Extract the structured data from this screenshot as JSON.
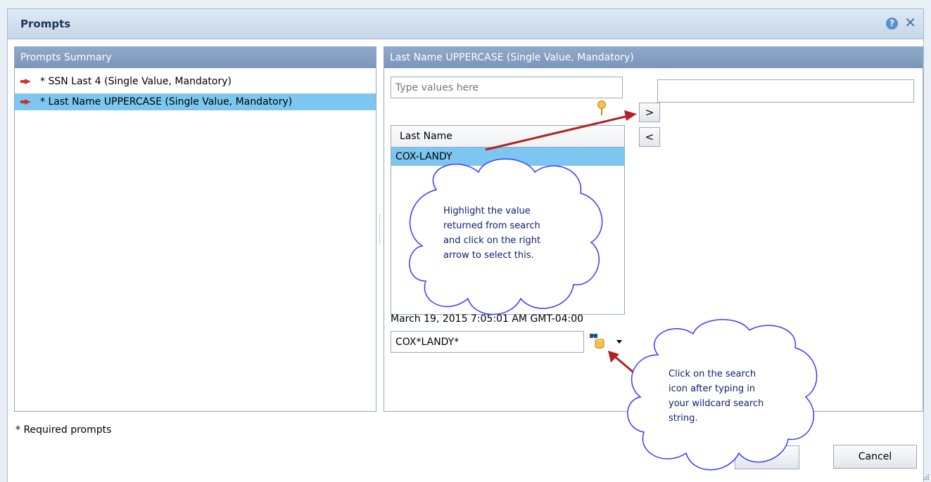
{
  "window": {
    "title": "Prompts",
    "help_icon": "help-icon",
    "close_icon": "close-icon",
    "close_glyph": "✕",
    "help_glyph": "?"
  },
  "left_panel": {
    "header": "Prompts Summary",
    "items": [
      {
        "label": "* SSN Last 4 (Single Value, Mandatory)",
        "icon": "red-arrow-icon",
        "selected": false
      },
      {
        "label": "* Last Name UPPERCASE (Single Value, Mandatory)",
        "icon": "red-arrow-icon",
        "selected": true
      }
    ]
  },
  "right_panel": {
    "header": "Last Name UPPERCASE (Single Value, Mandatory)",
    "type_values_placeholder": "Type values here",
    "add_button": ">",
    "remove_button": "<",
    "list": {
      "column_header": "Last Name",
      "rows": [
        "COX-LANDY"
      ]
    },
    "selected_value": "",
    "timestamp": "March 19, 2015 7:05:01 AM GMT-04:00",
    "search_value": "COX*LANDY*"
  },
  "footer": {
    "required_note": "* Required prompts",
    "ok_label": "",
    "cancel_label": "Cancel"
  },
  "annotations": {
    "callout_1": [
      "Highlight the value",
      "returned from search",
      "and click on the right",
      "arrow to select this."
    ],
    "callout_2": [
      "Click on the search",
      "icon after typing in",
      "your wildcard search",
      "string."
    ]
  },
  "colors": {
    "header_blue": "#8fa9c8",
    "selected_row": "#7cc6ef",
    "arrow_red": "#b22222",
    "callout_border": "#3e3eff"
  }
}
